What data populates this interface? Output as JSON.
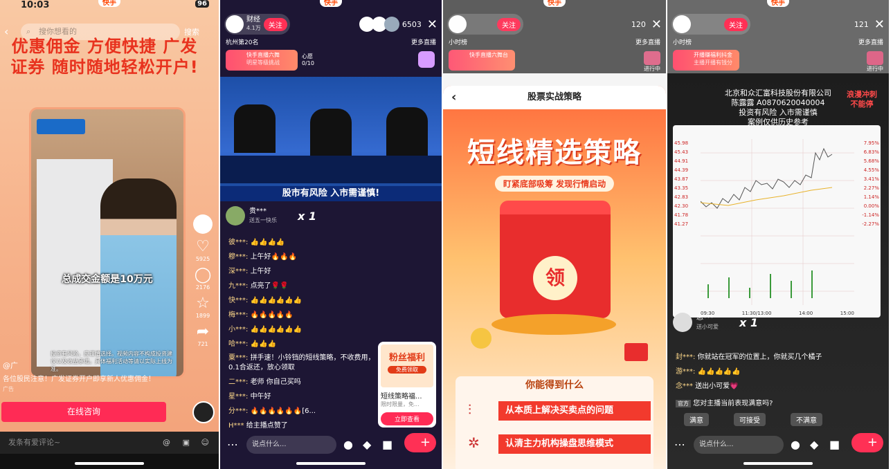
{
  "panel1": {
    "status": {
      "time": "10:03",
      "battery": "96"
    },
    "kuaishou_label": "快手",
    "search_placeholder": "搜你想看的",
    "search_button": "搜索",
    "headline": "优惠佣金 方便快捷 广发证券 随时随地轻松开户!",
    "board_text": "总成交金额是10万元",
    "caption_small": "投资有风险，应谨慎选择。视频内容不构成投资建议以及收益承诺。具体福利活动等请以实际上线为准。",
    "side": {
      "likes": "5925",
      "comments": "2176",
      "favorites": "1899",
      "shares": "721"
    },
    "author": "@广",
    "description": "各位股民注意！广发证券开户即享新人优惠佣金！",
    "ad_tag": "广告",
    "cta": "在线咨询",
    "comment_placeholder": "发条有爱评论~"
  },
  "panel2": {
    "kuaishou_label": "快手",
    "host_name": "财经",
    "host_fans": "4.1万",
    "follow": "关注",
    "viewers": "6503",
    "rank": "杭州第20名",
    "more_live": "更多直播",
    "promo_tile": "快手直播六舞",
    "promo_tile_sub": "明星等级挑战",
    "wish": "心愿",
    "wish_count": "0/10",
    "tv_ticker": "股市有风险  入市需谨慎!",
    "gift_user": "贵***",
    "gift_desc": "送五一快乐",
    "gift_count": "x 1",
    "chat": [
      {
        "name": "彼***:",
        "text": "👍👍👍👍"
      },
      {
        "name": "穆***:",
        "text": "上午好🔥🔥🔥"
      },
      {
        "name": "深***:",
        "text": "上午好"
      },
      {
        "name": "九***:",
        "text": "点亮了🌹🌹"
      },
      {
        "name": "快***:",
        "text": "👍👍👍👍👍👍"
      },
      {
        "name": "梅***:",
        "text": "🔥🔥🔥🔥🔥"
      },
      {
        "name": "小***:",
        "text": "👍👍👍👍👍👍"
      },
      {
        "name": "哈***:",
        "text": "👍👍👍"
      },
      {
        "name": "粟***:",
        "text": "拼手速！小铃铛的短线策略，不收费用，0.1合返还，放心领取"
      },
      {
        "name": "二***:",
        "text": "老师 你自己买吗"
      },
      {
        "name": "星***:",
        "text": "中午好"
      },
      {
        "name": "分***:",
        "text": "🔥🔥🔥🔥🔥🔥[6..."
      },
      {
        "name": "H***",
        "text": "给主播点赞了"
      }
    ],
    "promo_card": {
      "badge": "粉丝福利",
      "badge_sub": "免费领取",
      "title": "短线策略福...",
      "sub": "限时限量，免...",
      "button": "立即查看"
    },
    "say_placeholder": "说点什么..."
  },
  "panel3": {
    "kuaishou_label": "快手",
    "follow": "关注",
    "viewers": "120",
    "more_live": "更多直播",
    "hour_rank": "小时榜",
    "promo_tile": "快手直播六舞台",
    "in_progress": "进行中",
    "title": "股票实战策略",
    "big_title": "短线精选策略",
    "subtitle": "盯紧底部吸筹  发现行情启动",
    "seal": "领",
    "benefit_title": "你能得到什么",
    "benefits": [
      "从本质上解决买卖点的问题",
      "认清主力机构操盘思维模式"
    ]
  },
  "panel4": {
    "kuaishou_label": "快手",
    "follow": "关注",
    "viewers": "121",
    "more_live": "更多直播",
    "hour_rank": "小时榜",
    "promo_tile": "开播赚福利抖金",
    "promo_tile_sub": "主播开播有钱分",
    "in_progress": "进行中",
    "badge": "浪漫冲刺 不能停",
    "caption": [
      "北京和众汇富科技股份有限公司",
      "陈露露 A0870620040004",
      "投资有风险  入市需谨慎",
      "案例仅供历史参考"
    ],
    "chart_prices": [
      "45.98",
      "45.43",
      "44.91",
      "44.39",
      "43.87",
      "43.35",
      "42.83",
      "42.30",
      "41.78",
      "41.27"
    ],
    "chart_pcts": [
      "7.95%",
      "6.83%",
      "5.68%",
      "4.55%",
      "3.41%",
      "2.27%",
      "1.14%",
      "0.00%",
      "-1.14%",
      "-2.27%"
    ],
    "chart_times": [
      "09:30",
      "11:30/13:00",
      "14:00",
      "15:00"
    ],
    "gift_user": "念***",
    "gift_desc": "送小可爱",
    "gift_count": "x 1",
    "chat": [
      {
        "name": "封***:",
        "text": "你就站在冠军的位置上，你就买几个橘子"
      },
      {
        "name": "游***:",
        "text": "👍👍👍👍👍"
      },
      {
        "name": "念***",
        "text": "送出小可爱💗"
      }
    ],
    "survey_label": "官方",
    "survey_q": "您对主播当前表现满意吗?",
    "survey_options": [
      "满意",
      "可接受",
      "不满意"
    ],
    "say_placeholder": "说点什么..."
  }
}
